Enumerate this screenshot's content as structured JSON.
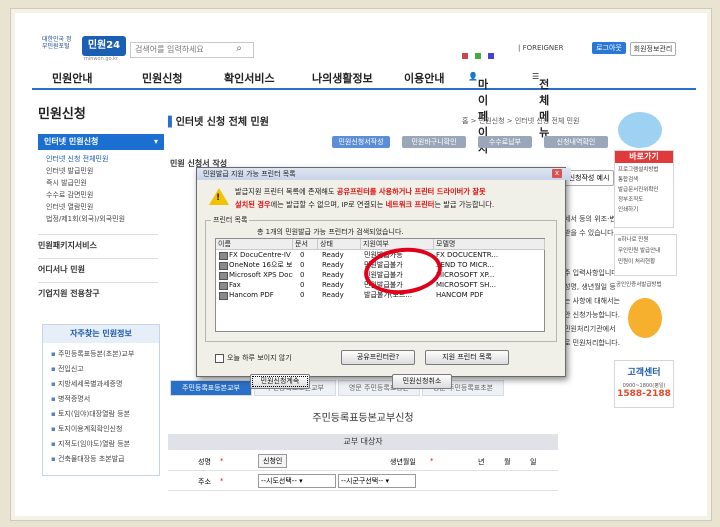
{
  "header": {
    "logo_small": "대한민국 정부민원포털",
    "logo_main": "민원24",
    "logo_url": "minwon.go.kr",
    "search_placeholder": "검색어를 입력하세요",
    "top_links": [
      "|",
      "FOREIGNER"
    ],
    "login_button": "로그아웃",
    "info_button": "회원정보관리"
  },
  "nav": {
    "items": [
      "민원안내",
      "민원신청",
      "확인서비스",
      "나의생활정보",
      "이용안내"
    ],
    "mypage": "마이페이지",
    "allmenu": "전체메뉴"
  },
  "sidebar": {
    "title": "민원신청",
    "active": "인터넷 민원신청",
    "sub_items": [
      "인터넷 신청 전체민원",
      "인터넷 발급민원",
      "즉시 발급민원",
      "수수료 감면민원",
      "인터넷 열람민원",
      "법정/제1회(외국)/외국민원"
    ],
    "sections": [
      "민원패키지서비스",
      "어디서나 민원",
      "기업지원 전용창구"
    ],
    "fav_title": "자주찾는 민원정보",
    "fav_items": [
      "주민등록표등본(초본)교부",
      "전입신고",
      "지방세세목별과세증명",
      "병적증명서",
      "토지(임야)대장열람 등본",
      "토지이용계획확인신청",
      "지적도(임야도)열람 등본",
      "건축물대장등 초본발급"
    ]
  },
  "content": {
    "title": "인터넷 신청 전체 민원",
    "breadcrumb": "홈 > 민원신청 > 인터넷 신청 전체 민원",
    "steps": [
      "민원신청서작성",
      "민원바구니확인",
      "수수료납부",
      "신청내역확인"
    ],
    "section_title": "민원 신청서 작성",
    "write_example_button": "신청작성 예시",
    "side_text_1": "세서 등의 위조·변조",
    "side_text_2": "받을 수 있습니다.",
    "side_text_3": "주 입력사항입니다.",
    "side_text_4": "성명, 생년월일 등",
    "side_text_5": "는 사항에 대해서는",
    "side_text_6": "안 신청가능합니다.",
    "side_text_7": "민원처리기관에서",
    "side_text_8": "로 민원처리합니다.",
    "tabs": [
      "주민등록표등본교부",
      "주민등록표초본교부",
      "영문 주민등록표등본",
      "영문 주민등록표초본"
    ],
    "form_title": "주민등록표등본교부신청",
    "form_head": "교부 대상자",
    "name_label": "성명",
    "required_mark": "*",
    "applicant_button": "신청인",
    "birth_label": "생년월일",
    "birth_units": [
      "년",
      "월",
      "일"
    ],
    "address_label": "주소",
    "sido_select": "--시도선택--",
    "sigungu_select": "--시군구선택--"
  },
  "right_column": {
    "quick_title": "바로가기",
    "quick_items": [
      "프로그램설치방법",
      "통합검색",
      "발급문서진위확인",
      "정부조직도",
      "인쇄하기"
    ],
    "more_items": [
      "e하나로 민원",
      "무인민원 발급안내",
      "민원이 처리현황"
    ],
    "notice": "공인인증서발급방법",
    "center_title": "고객센터",
    "center_hours": "0900~1800(평일)",
    "center_phone": "1588-2188"
  },
  "dialog": {
    "title": "민원발급 지원 가능 프린터 목록",
    "close": "x",
    "message_line1_a": "발급지원 프린터 목록에 존재해도 ",
    "message_line1_hl": "공유프린터를 사용하거나 프린터 드라이버가 잘못",
    "message_line2_hl": "설치된 경우",
    "message_line2_a": "에는 발급할 수 없으며, IP로 연결되는 ",
    "message_line2_hl2": "네트워크 프린터",
    "message_line2_b": "는 발급 가능합니다.",
    "group_label": "프린터 목록",
    "group_sub": "총 1개의 민원발급 가능 프린터가 검색되었습니다.",
    "columns": [
      "이름",
      "문서",
      "상태",
      "지원여부",
      "모델명"
    ],
    "rows": [
      {
        "name": "FX DocuCentre-IV 3...",
        "docs": "0",
        "state": "Ready",
        "support": "민원발급가능",
        "model": "FX DOCUCENTR..."
      },
      {
        "name": "OneNote 16으로 보...",
        "docs": "0",
        "state": "Ready",
        "support": "민원발급불가",
        "model": "SEND TO MICR..."
      },
      {
        "name": "Microsoft XPS Docu...",
        "docs": "0",
        "state": "Ready",
        "support": "민원발급불가",
        "model": "MICROSOFT XP..."
      },
      {
        "name": "Fax",
        "docs": "0",
        "state": "Ready",
        "support": "민원발급불가",
        "model": "MICROSOFT SH..."
      },
      {
        "name": "Hancom PDF",
        "docs": "0",
        "state": "Ready",
        "support": "발급불가(모드...",
        "model": "HANCOM PDF"
      }
    ],
    "checkbox_label": "오늘 하루 보이지 않기",
    "shared_button": "공유프린터란?",
    "support_list_button": "지원 프린터 목록",
    "continue_button": "민원신청계속",
    "cancel_button": "민원신청취소"
  }
}
